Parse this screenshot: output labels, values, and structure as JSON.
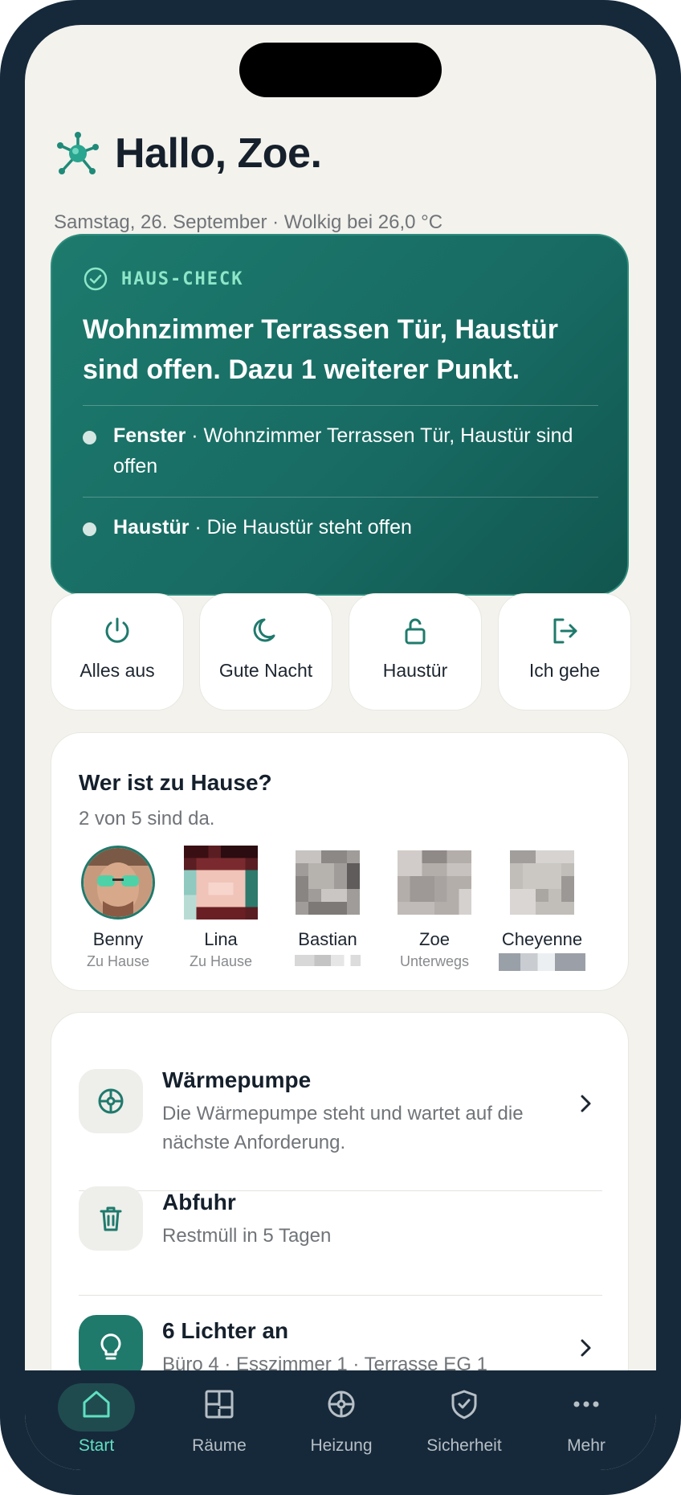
{
  "header": {
    "greeting": "Hallo, Zoe.",
    "subline": "Samstag, 26. September · Wolkig bei 26,0 °C"
  },
  "haus_check": {
    "title": "HAUS-CHECK",
    "headline": "Wohnzimmer Terrassen Tür, Haustür sind offen. Dazu 1 weiterer Punkt.",
    "items": [
      {
        "bold": "Fenster",
        "text": " · Wohnzimmer Terrassen Tür, Haustür sind offen"
      },
      {
        "bold": "Haustür",
        "text": " · Die Haustür steht offen"
      }
    ]
  },
  "quick_actions": [
    {
      "label": "Alles aus",
      "icon": "power-icon"
    },
    {
      "label": "Gute Nacht",
      "icon": "moon-icon"
    },
    {
      "label": "Haustür",
      "icon": "unlock-icon"
    },
    {
      "label": "Ich gehe",
      "icon": "logout-icon"
    }
  ],
  "who_home": {
    "title": "Wer ist zu Hause?",
    "subtitle": "2 von 5 sind da.",
    "people": [
      {
        "name": "Benny",
        "status": "Zu Hause"
      },
      {
        "name": "Lina",
        "status": "Zu Hause"
      },
      {
        "name": "Bastian",
        "status": ""
      },
      {
        "name": "Zoe",
        "status": "Unterwegs"
      },
      {
        "name": "Cheyenne",
        "status": ""
      }
    ]
  },
  "list": [
    {
      "title": "Wärmepumpe",
      "subtitle": "Die Wärmepumpe steht und wartet auf die nächste Anforderung.",
      "icon": "heating-icon"
    },
    {
      "title": "Abfuhr",
      "subtitle": "Restmüll in 5 Tagen",
      "icon": "trash-icon"
    },
    {
      "title": "6 Lichter an",
      "subtitle": "Büro 4 · Esszimmer 1 · Terrasse EG 1",
      "icon": "lightbulb-icon"
    }
  ],
  "nav": [
    {
      "label": "Start",
      "icon": "home-icon"
    },
    {
      "label": "Räume",
      "icon": "rooms-icon"
    },
    {
      "label": "Heizung",
      "icon": "heating-icon"
    },
    {
      "label": "Sicherheit",
      "icon": "shield-icon"
    },
    {
      "label": "Mehr",
      "icon": "more-icon"
    }
  ],
  "colors": {
    "accent": "#1f7a6c",
    "check_title": "#8de6c8",
    "nav_bg": "#16293a",
    "nav_active": "#5fe0c1"
  }
}
